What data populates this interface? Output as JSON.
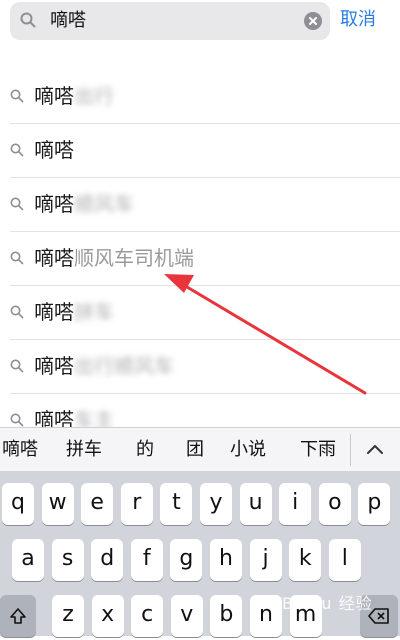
{
  "search": {
    "query": "嘀嗒",
    "cancel_label": "取消"
  },
  "suggestions": [
    {
      "prefix": "嘀嗒",
      "rest": "出行",
      "blurred": true
    },
    {
      "prefix": "嘀嗒",
      "rest": "",
      "blurred": false
    },
    {
      "prefix": "嘀嗒",
      "rest": "顺风车",
      "blurred": true
    },
    {
      "prefix": "嘀嗒",
      "rest": "顺风车司机端",
      "blurred": false
    },
    {
      "prefix": "嘀嗒",
      "rest": "拼车",
      "blurred": true
    },
    {
      "prefix": "嘀嗒",
      "rest": "出行顺风车",
      "blurred": true
    },
    {
      "prefix": "嘀嗒",
      "rest": "车主",
      "blurred": true
    }
  ],
  "predictions": [
    "嘀嗒",
    "拼车",
    "的",
    "团",
    "小说",
    "下雨"
  ],
  "keyboard": {
    "row1": [
      "q",
      "w",
      "e",
      "r",
      "t",
      "y",
      "u",
      "i",
      "o",
      "p"
    ],
    "row2": [
      "a",
      "s",
      "d",
      "f",
      "g",
      "h",
      "j",
      "k",
      "l"
    ],
    "row3": [
      "z",
      "x",
      "c",
      "v",
      "b",
      "n",
      "m"
    ]
  },
  "annotation_color": "#e8343a",
  "accent_color": "#2a7ee0",
  "watermark_text": "Baidu 经验"
}
